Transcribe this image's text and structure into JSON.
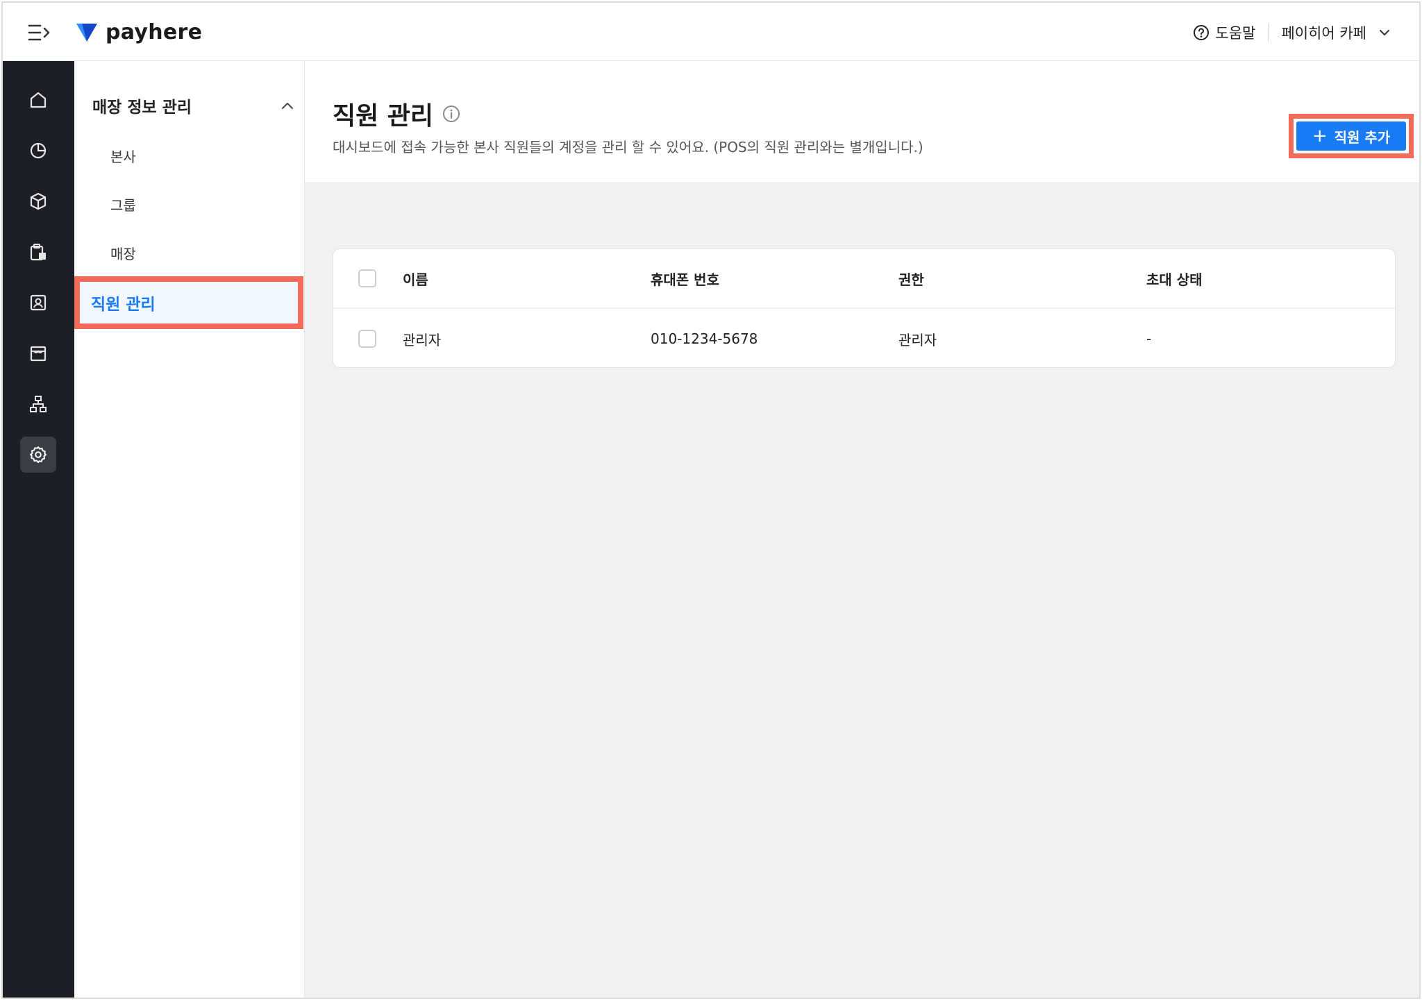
{
  "app": {
    "logo_text": "payhere"
  },
  "topbar": {
    "help_label": "도움말",
    "store_name": "페이히어 카페"
  },
  "rail": {
    "items": [
      {
        "icon": "home-icon"
      },
      {
        "icon": "pie-chart-icon"
      },
      {
        "icon": "box-icon"
      },
      {
        "icon": "clipboard-icon"
      },
      {
        "icon": "contact-icon"
      },
      {
        "icon": "store-icon"
      },
      {
        "icon": "org-chart-icon"
      },
      {
        "icon": "gear-icon",
        "active": true
      }
    ]
  },
  "subnav": {
    "group_label": "매장 정보 관리",
    "items": [
      "본사",
      "그룹",
      "매장"
    ],
    "active_label": "직원 관리"
  },
  "page": {
    "title": "직원 관리",
    "description": "대시보드에 접속 가능한 본사 직원들의 계정을 관리 할 수 있어요. (POS의 직원 관리와는 별개입니다.)",
    "add_button": "직원 추가"
  },
  "table": {
    "columns": [
      "이름",
      "휴대폰 번호",
      "권한",
      "초대 상태"
    ],
    "rows": [
      [
        "관리자",
        "010-1234-5678",
        "관리자",
        "-"
      ]
    ]
  },
  "colors": {
    "accent": "#1a7cf5",
    "highlight": "#f26a5a",
    "rail": "#1d1f24"
  }
}
